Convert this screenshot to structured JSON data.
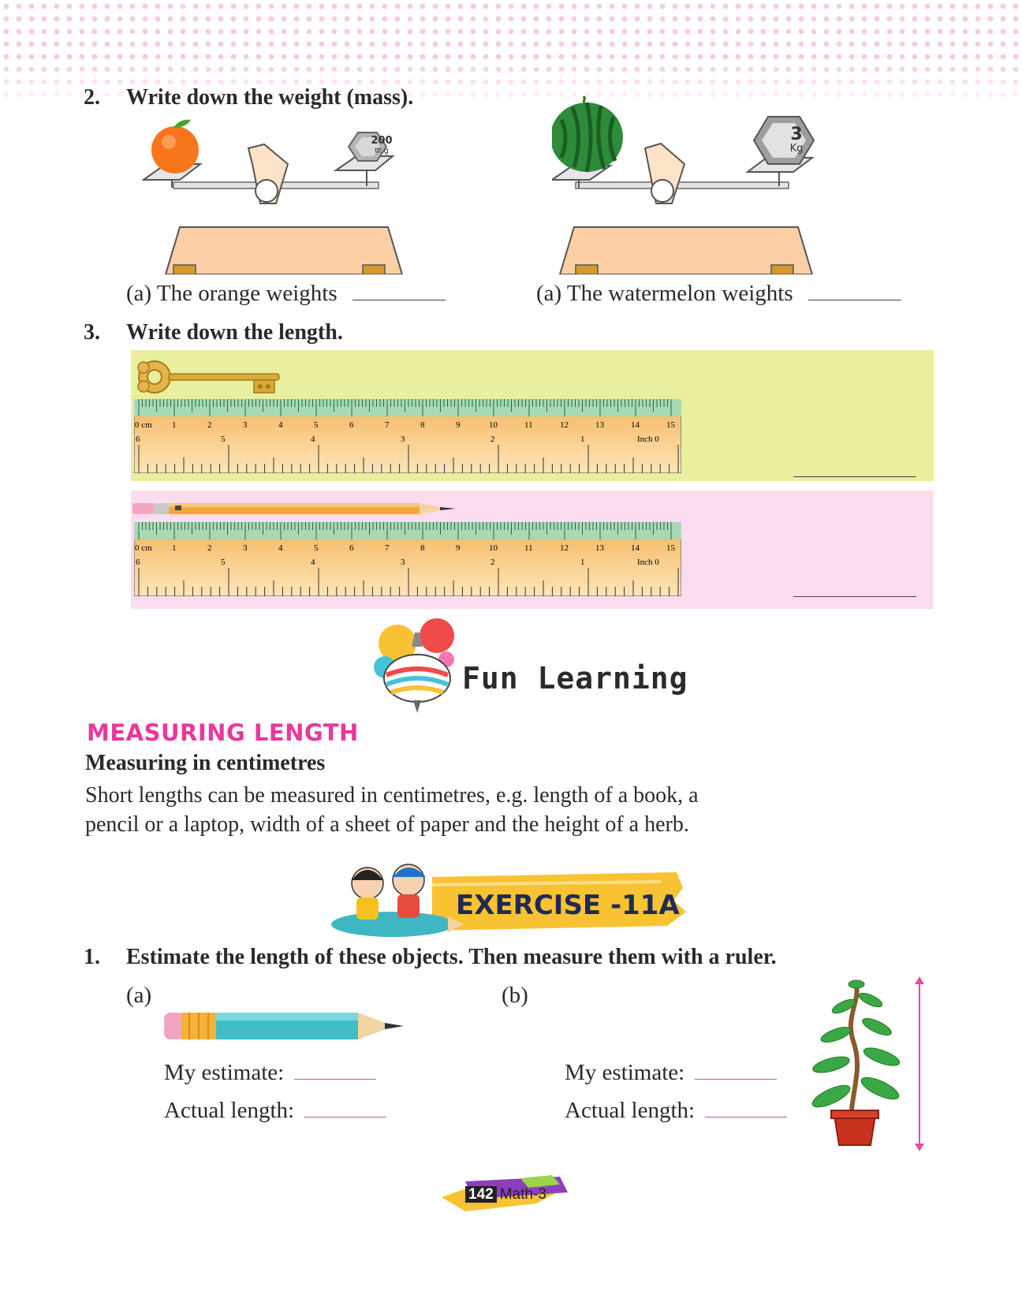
{
  "q2": {
    "number": "2.",
    "text": "Write down the weight (mass).",
    "a_left": "(a)  The orange weights",
    "a_right": "(a)  The watermelon weights",
    "weight_left_value": "200",
    "weight_left_unit": "ग्रा.g",
    "weight_right_value": "3",
    "weight_right_unit": "Kg"
  },
  "q3": {
    "number": "3.",
    "text": "Write down the length."
  },
  "ruler": {
    "cm_label": "0 cm",
    "cm_ticks": [
      "1",
      "2",
      "3",
      "4",
      "5",
      "6",
      "7",
      "8",
      "9",
      "10",
      "11",
      "12",
      "13",
      "14",
      "15"
    ],
    "inch_label": "Inch 0",
    "inch_ticks": [
      "6",
      "5",
      "4",
      "3",
      "2",
      "1"
    ]
  },
  "fun_learning": "Fun Learning",
  "section": {
    "heading": "MEASURING LENGTH",
    "subheading": "Measuring in centimetres",
    "body_line1": "Short lengths can be measured in centimetres, e.g. length of a book, a",
    "body_line2": "pencil or a laptop, width of a sheet of paper and the height of a herb."
  },
  "exercise": {
    "title": "EXERCISE -11A"
  },
  "ex_q1": {
    "number": "1.",
    "text": "Estimate the length of these objects. Then measure them with a ruler.",
    "label_a": "(a)",
    "label_b": "(b)",
    "estimate_label": "My estimate:",
    "actual_label": "Actual length:"
  },
  "footer": {
    "page": "142",
    "book": "Math-3"
  },
  "colors": {
    "pink_accent": "#e8399c",
    "yellow_band": "#e9ef9d",
    "pink_band": "#fbdcee"
  }
}
